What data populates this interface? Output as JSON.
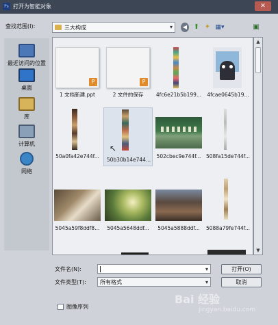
{
  "window": {
    "title": "打开为智能对象",
    "app_icon_text": "Ps",
    "close_glyph": "✕"
  },
  "lookin": {
    "label": "查找范围(I):",
    "value": "三大构成",
    "arrow": "▾"
  },
  "toolbar": {
    "back_glyph": "◀",
    "up_glyph": "⬆",
    "newfolder_glyph": "✦",
    "views_glyph": "▦▾",
    "extra_glyph": "▣"
  },
  "places": [
    {
      "label": "最近访问的位置",
      "icon": "recent-icon"
    },
    {
      "label": "桌面",
      "icon": "desktop-icon"
    },
    {
      "label": "库",
      "icon": "library-icon"
    },
    {
      "label": "计算机",
      "icon": "computer-icon"
    },
    {
      "label": "网络",
      "icon": "network-icon"
    }
  ],
  "files": [
    {
      "name": "1 文档新建.ppt",
      "badge": "P"
    },
    {
      "name": "2 文件的保存",
      "badge": "P"
    },
    {
      "name": "4fc6e21b5b199..."
    },
    {
      "name": "4fcae0645b19..."
    },
    {
      "name": "50a0fa42e744f..."
    },
    {
      "name": "50b30b14e744..."
    },
    {
      "name": "502cbec9e744f..."
    },
    {
      "name": "508fa15de744f..."
    },
    {
      "name": "5045a59f8ddf8..."
    },
    {
      "name": "5045a5648ddf..."
    },
    {
      "name": "5045a5888ddf..."
    },
    {
      "name": "5088a79fe744f..."
    }
  ],
  "form": {
    "filename_label": "文件名(N):",
    "filename_value": "",
    "filetype_label": "文件类型(T):",
    "filetype_value": "所有格式",
    "combo_arrow": "▾",
    "open_button": "打开(O)",
    "cancel_button": "取消",
    "image_sequence_label": "图像序列"
  },
  "watermark": {
    "text": "Bai 经验",
    "sub": "jingyan.baidu.com"
  },
  "colors": {
    "titlebar": "#3c4654",
    "folder": "#d9b24b",
    "ppt_badge": "#e18a2a"
  }
}
